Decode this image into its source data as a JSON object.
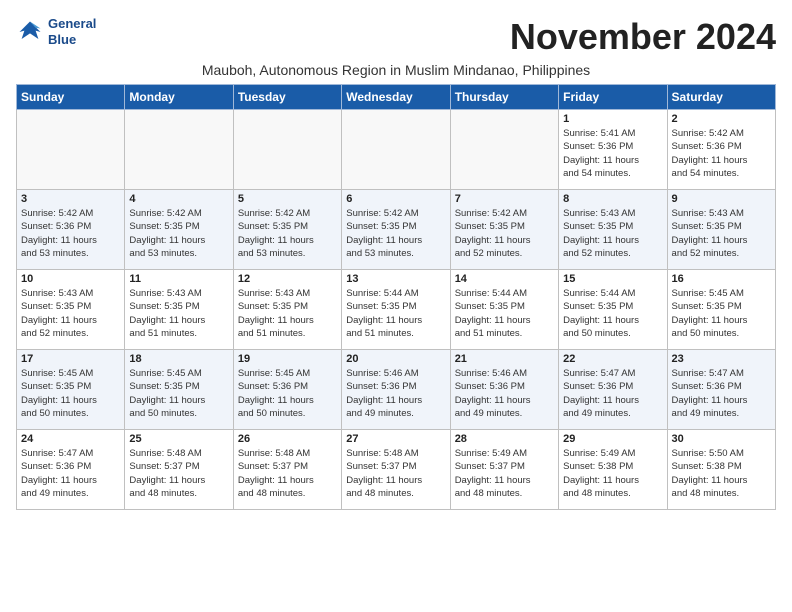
{
  "header": {
    "logo_line1": "General",
    "logo_line2": "Blue",
    "month_year": "November 2024",
    "subtitle": "Mauboh, Autonomous Region in Muslim Mindanao, Philippines"
  },
  "weekdays": [
    "Sunday",
    "Monday",
    "Tuesday",
    "Wednesday",
    "Thursday",
    "Friday",
    "Saturday"
  ],
  "weeks": [
    [
      {
        "day": "",
        "detail": ""
      },
      {
        "day": "",
        "detail": ""
      },
      {
        "day": "",
        "detail": ""
      },
      {
        "day": "",
        "detail": ""
      },
      {
        "day": "",
        "detail": ""
      },
      {
        "day": "1",
        "detail": "Sunrise: 5:41 AM\nSunset: 5:36 PM\nDaylight: 11 hours\nand 54 minutes."
      },
      {
        "day": "2",
        "detail": "Sunrise: 5:42 AM\nSunset: 5:36 PM\nDaylight: 11 hours\nand 54 minutes."
      }
    ],
    [
      {
        "day": "3",
        "detail": "Sunrise: 5:42 AM\nSunset: 5:36 PM\nDaylight: 11 hours\nand 53 minutes."
      },
      {
        "day": "4",
        "detail": "Sunrise: 5:42 AM\nSunset: 5:35 PM\nDaylight: 11 hours\nand 53 minutes."
      },
      {
        "day": "5",
        "detail": "Sunrise: 5:42 AM\nSunset: 5:35 PM\nDaylight: 11 hours\nand 53 minutes."
      },
      {
        "day": "6",
        "detail": "Sunrise: 5:42 AM\nSunset: 5:35 PM\nDaylight: 11 hours\nand 53 minutes."
      },
      {
        "day": "7",
        "detail": "Sunrise: 5:42 AM\nSunset: 5:35 PM\nDaylight: 11 hours\nand 52 minutes."
      },
      {
        "day": "8",
        "detail": "Sunrise: 5:43 AM\nSunset: 5:35 PM\nDaylight: 11 hours\nand 52 minutes."
      },
      {
        "day": "9",
        "detail": "Sunrise: 5:43 AM\nSunset: 5:35 PM\nDaylight: 11 hours\nand 52 minutes."
      }
    ],
    [
      {
        "day": "10",
        "detail": "Sunrise: 5:43 AM\nSunset: 5:35 PM\nDaylight: 11 hours\nand 52 minutes."
      },
      {
        "day": "11",
        "detail": "Sunrise: 5:43 AM\nSunset: 5:35 PM\nDaylight: 11 hours\nand 51 minutes."
      },
      {
        "day": "12",
        "detail": "Sunrise: 5:43 AM\nSunset: 5:35 PM\nDaylight: 11 hours\nand 51 minutes."
      },
      {
        "day": "13",
        "detail": "Sunrise: 5:44 AM\nSunset: 5:35 PM\nDaylight: 11 hours\nand 51 minutes."
      },
      {
        "day": "14",
        "detail": "Sunrise: 5:44 AM\nSunset: 5:35 PM\nDaylight: 11 hours\nand 51 minutes."
      },
      {
        "day": "15",
        "detail": "Sunrise: 5:44 AM\nSunset: 5:35 PM\nDaylight: 11 hours\nand 50 minutes."
      },
      {
        "day": "16",
        "detail": "Sunrise: 5:45 AM\nSunset: 5:35 PM\nDaylight: 11 hours\nand 50 minutes."
      }
    ],
    [
      {
        "day": "17",
        "detail": "Sunrise: 5:45 AM\nSunset: 5:35 PM\nDaylight: 11 hours\nand 50 minutes."
      },
      {
        "day": "18",
        "detail": "Sunrise: 5:45 AM\nSunset: 5:35 PM\nDaylight: 11 hours\nand 50 minutes."
      },
      {
        "day": "19",
        "detail": "Sunrise: 5:45 AM\nSunset: 5:36 PM\nDaylight: 11 hours\nand 50 minutes."
      },
      {
        "day": "20",
        "detail": "Sunrise: 5:46 AM\nSunset: 5:36 PM\nDaylight: 11 hours\nand 49 minutes."
      },
      {
        "day": "21",
        "detail": "Sunrise: 5:46 AM\nSunset: 5:36 PM\nDaylight: 11 hours\nand 49 minutes."
      },
      {
        "day": "22",
        "detail": "Sunrise: 5:47 AM\nSunset: 5:36 PM\nDaylight: 11 hours\nand 49 minutes."
      },
      {
        "day": "23",
        "detail": "Sunrise: 5:47 AM\nSunset: 5:36 PM\nDaylight: 11 hours\nand 49 minutes."
      }
    ],
    [
      {
        "day": "24",
        "detail": "Sunrise: 5:47 AM\nSunset: 5:36 PM\nDaylight: 11 hours\nand 49 minutes."
      },
      {
        "day": "25",
        "detail": "Sunrise: 5:48 AM\nSunset: 5:37 PM\nDaylight: 11 hours\nand 48 minutes."
      },
      {
        "day": "26",
        "detail": "Sunrise: 5:48 AM\nSunset: 5:37 PM\nDaylight: 11 hours\nand 48 minutes."
      },
      {
        "day": "27",
        "detail": "Sunrise: 5:48 AM\nSunset: 5:37 PM\nDaylight: 11 hours\nand 48 minutes."
      },
      {
        "day": "28",
        "detail": "Sunrise: 5:49 AM\nSunset: 5:37 PM\nDaylight: 11 hours\nand 48 minutes."
      },
      {
        "day": "29",
        "detail": "Sunrise: 5:49 AM\nSunset: 5:38 PM\nDaylight: 11 hours\nand 48 minutes."
      },
      {
        "day": "30",
        "detail": "Sunrise: 5:50 AM\nSunset: 5:38 PM\nDaylight: 11 hours\nand 48 minutes."
      }
    ]
  ]
}
